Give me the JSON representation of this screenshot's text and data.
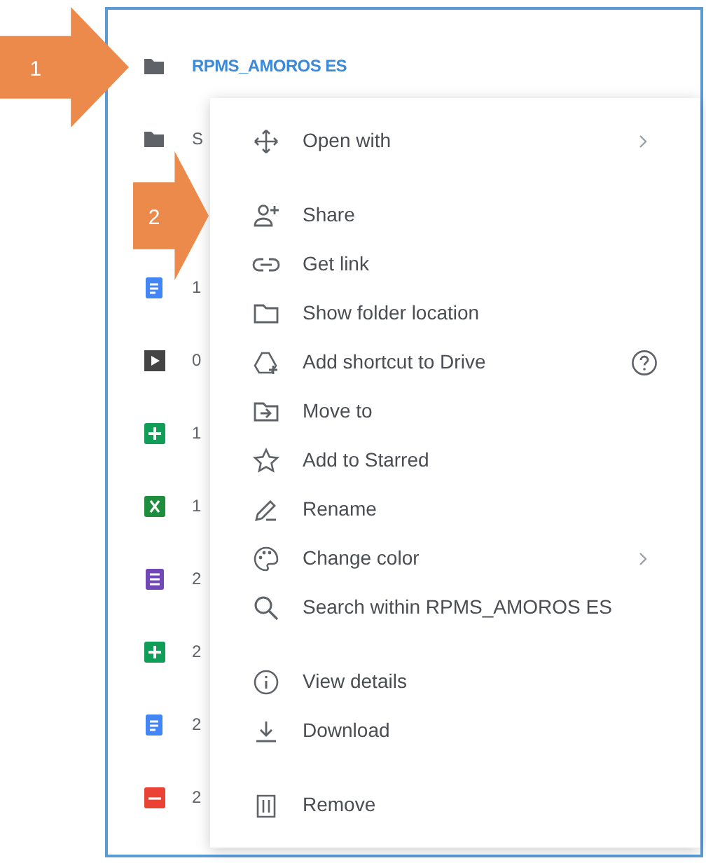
{
  "callouts": [
    {
      "number": "1"
    },
    {
      "number": "2"
    }
  ],
  "files": [
    {
      "kind": "folder",
      "name": "RPMS_AMOROS ES",
      "selected": true
    },
    {
      "kind": "folder",
      "name": "S",
      "selected": false
    },
    {
      "kind": "doc",
      "name": "1",
      "selected": false
    },
    {
      "kind": "video",
      "name": "0",
      "selected": false
    },
    {
      "kind": "sheet",
      "name": "1",
      "selected": false
    },
    {
      "kind": "excel",
      "name": "1",
      "selected": false
    },
    {
      "kind": "form",
      "name": "2",
      "selected": false
    },
    {
      "kind": "sheet",
      "name": "2",
      "selected": false
    },
    {
      "kind": "doc",
      "name": "2",
      "selected": false
    },
    {
      "kind": "pdf",
      "name": "2",
      "selected": false
    }
  ],
  "context_menu": {
    "groups": [
      [
        {
          "kind": "move",
          "label": "Open with",
          "submenu": true,
          "help": false
        }
      ],
      [
        {
          "kind": "share",
          "label": "Share",
          "submenu": false,
          "help": false
        },
        {
          "kind": "link",
          "label": "Get link",
          "submenu": false,
          "help": false
        },
        {
          "kind": "folder",
          "label": "Show folder location",
          "submenu": false,
          "help": false
        },
        {
          "kind": "shortcut",
          "label": "Add shortcut to Drive",
          "submenu": false,
          "help": true
        },
        {
          "kind": "moveto",
          "label": "Move to",
          "submenu": false,
          "help": false
        },
        {
          "kind": "star",
          "label": "Add to Starred",
          "submenu": false,
          "help": false
        },
        {
          "kind": "rename",
          "label": "Rename",
          "submenu": false,
          "help": false
        },
        {
          "kind": "color",
          "label": "Change color",
          "submenu": true,
          "help": false
        },
        {
          "kind": "search",
          "label": "Search within RPMS_AMOROS ES",
          "submenu": false,
          "help": false
        }
      ],
      [
        {
          "kind": "details",
          "label": "View details",
          "submenu": false,
          "help": false
        },
        {
          "kind": "download",
          "label": "Download",
          "submenu": false,
          "help": false
        }
      ],
      [
        {
          "kind": "remove",
          "label": "Remove",
          "submenu": false,
          "help": false
        }
      ]
    ]
  }
}
